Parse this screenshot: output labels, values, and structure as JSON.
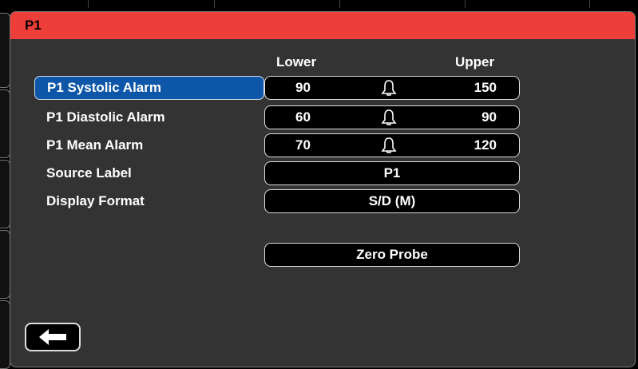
{
  "window": {
    "title": "P1"
  },
  "columns": {
    "lower": "Lower",
    "upper": "Upper"
  },
  "rows": [
    {
      "label": "P1 Systolic Alarm",
      "lower": "90",
      "upper": "150",
      "selected": true
    },
    {
      "label": "P1 Diastolic Alarm",
      "lower": "60",
      "upper": "90",
      "selected": false
    },
    {
      "label": "P1 Mean Alarm",
      "lower": "70",
      "upper": "120",
      "selected": false
    }
  ],
  "source": {
    "label": "Source Label",
    "value": "P1"
  },
  "display": {
    "label": "Display Format",
    "value": "S/D (M)"
  },
  "zero_probe": {
    "label": "Zero Probe"
  },
  "icons": {
    "alarm": "bell-icon",
    "back": "back-arrow-icon"
  },
  "colors": {
    "title_bar": "#ee3e3a",
    "selected": "#0d56a8",
    "panel": "#333333"
  }
}
